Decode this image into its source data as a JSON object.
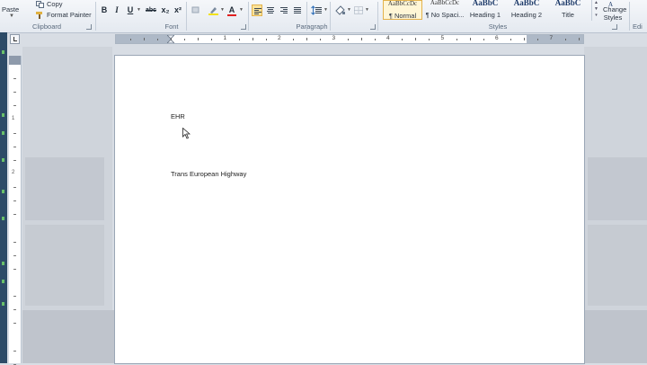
{
  "clipboard": {
    "paste_label": "Paste",
    "copy_label": "Copy",
    "format_painter_label": "Format Painter",
    "group_label": "Clipboard"
  },
  "font": {
    "group_label": "Font",
    "buttons": [
      "B",
      "I",
      "U",
      "abc",
      "x₂",
      "x²"
    ]
  },
  "paragraph": {
    "group_label": "Paragraph"
  },
  "styles": {
    "group_label": "Styles",
    "items": [
      {
        "preview": "AaBbCcDc",
        "name": "¶ Normal"
      },
      {
        "preview": "AaBbCcDc",
        "name": "¶ No Spaci..."
      },
      {
        "preview": "AaBbC",
        "name": "Heading 1"
      },
      {
        "preview": "AaBbC",
        "name": "Heading 2"
      },
      {
        "preview": "AaBbC",
        "name": "Title"
      }
    ],
    "change_styles_label": "Change Styles",
    "editing_label": "Edi"
  },
  "ruler": {
    "numbers": [
      "1",
      "2",
      "3",
      "4",
      "5",
      "6",
      "7"
    ]
  },
  "vruler": {
    "numbers": [
      "1",
      "2"
    ]
  },
  "document": {
    "line1": "EHR",
    "line2": "Trans European Highway"
  },
  "colors": {
    "accent": "#e3b24c",
    "selected_bg": "#fbe39a",
    "ribbon_bg": "#eef1f5"
  }
}
